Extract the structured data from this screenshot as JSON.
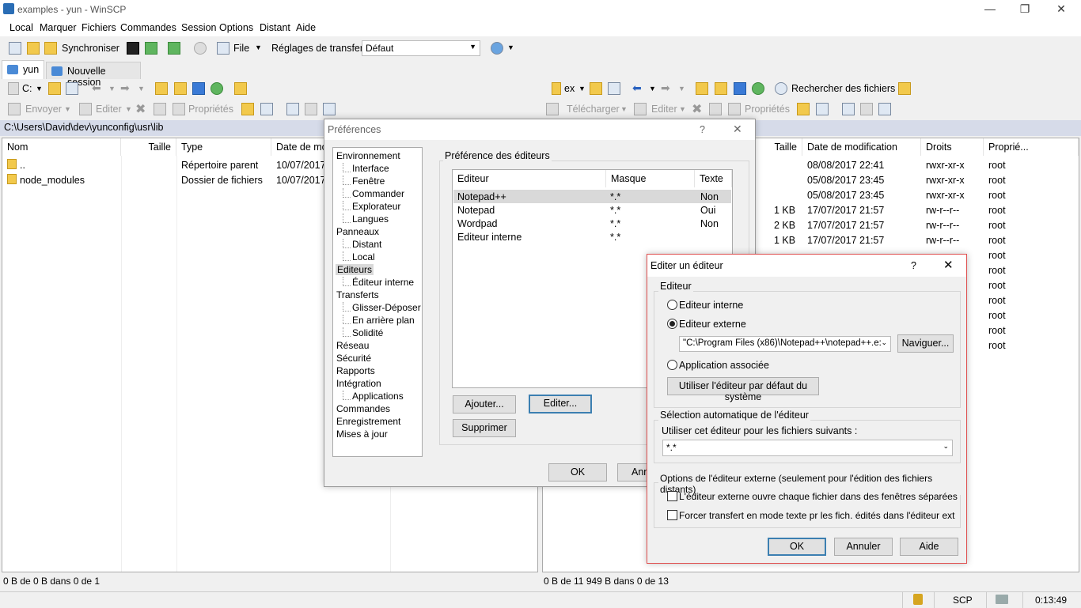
{
  "window": {
    "title": "examples - yun - WinSCP",
    "min": "—",
    "restore": "❐",
    "close": "✕"
  },
  "menu": [
    "Local",
    "Marquer",
    "Fichiers",
    "Commandes",
    "Session",
    "Options",
    "Distant",
    "Aide"
  ],
  "toolbar": {
    "sync_label": "Synchroniser",
    "file_label": "File",
    "transfer_settings_label": "Réglages de transfert",
    "transfer_preset": "Défaut"
  },
  "tabs": [
    {
      "label": "yun"
    },
    {
      "label": "Nouvelle session"
    }
  ],
  "local": {
    "drive": "C:",
    "send_label": "Envoyer",
    "edit_label": "Editer",
    "props_label": "Propriétés",
    "path": "C:\\Users\\David\\dev\\yunconfig\\usr\\lib",
    "columns": [
      "Nom",
      "Taille",
      "Type",
      "Date de mo"
    ],
    "rows": [
      {
        "name": "..",
        "type": "Répertoire parent",
        "date": "10/07/2017"
      },
      {
        "name": "node_modules",
        "type": "Dossier de fichiers",
        "date": "10/07/2017"
      }
    ],
    "status": "0 B de 0 B dans 0 de 1"
  },
  "remote": {
    "dir": "ex",
    "find_label": "Rechercher des fichiers",
    "download_label": "Télécharger",
    "edit_label": "Editer",
    "props_label": "Propriétés",
    "columns": [
      "Taille",
      "Date de modification",
      "Droits",
      "Proprié..."
    ],
    "rows": [
      {
        "size": "",
        "date": "08/08/2017 22:41",
        "rights": "rwxr-xr-x",
        "owner": "root"
      },
      {
        "size": "",
        "date": "05/08/2017 23:45",
        "rights": "rwxr-xr-x",
        "owner": "root"
      },
      {
        "size": "",
        "date": "05/08/2017 23:45",
        "rights": "rwxr-xr-x",
        "owner": "root"
      },
      {
        "size": "1 KB",
        "date": "17/07/2017 21:57",
        "rights": "rw-r--r--",
        "owner": "root"
      },
      {
        "size": "2 KB",
        "date": "17/07/2017 21:57",
        "rights": "rw-r--r--",
        "owner": "root"
      },
      {
        "size": "1 KB",
        "date": "17/07/2017 21:57",
        "rights": "rw-r--r--",
        "owner": "root"
      },
      {
        "size": "",
        "date": "",
        "rights": "",
        "owner": "root"
      },
      {
        "size": "",
        "date": "",
        "rights": "",
        "owner": "root"
      },
      {
        "size": "",
        "date": "",
        "rights": "",
        "owner": "root"
      },
      {
        "size": "",
        "date": "",
        "rights": "",
        "owner": "root"
      },
      {
        "size": "",
        "date": "",
        "rights": "",
        "owner": "root"
      },
      {
        "size": "",
        "date": "",
        "rights": "",
        "owner": "root"
      },
      {
        "size": "",
        "date": "",
        "rights": "",
        "owner": "root"
      }
    ],
    "status": "0 B de 11 949 B dans 0 de 13"
  },
  "bottom": {
    "protocol": "SCP",
    "time": "0:13:49"
  },
  "prefs": {
    "title": "Préférences",
    "help": "?",
    "close": "✕",
    "tree": [
      {
        "label": "Environnement",
        "level": 0
      },
      {
        "label": "Interface",
        "level": 1
      },
      {
        "label": "Fenêtre",
        "level": 1
      },
      {
        "label": "Commander",
        "level": 1
      },
      {
        "label": "Explorateur",
        "level": 1
      },
      {
        "label": "Langues",
        "level": 1
      },
      {
        "label": "Panneaux",
        "level": 0
      },
      {
        "label": "Distant",
        "level": 1
      },
      {
        "label": "Local",
        "level": 1
      },
      {
        "label": "Editeurs",
        "level": 0,
        "selected": true
      },
      {
        "label": "Éditeur interne",
        "level": 1
      },
      {
        "label": "Transferts",
        "level": 0
      },
      {
        "label": "Glisser-Déposer",
        "level": 1
      },
      {
        "label": "En arrière plan",
        "level": 1
      },
      {
        "label": "Solidité",
        "level": 1
      },
      {
        "label": "Réseau",
        "level": 0
      },
      {
        "label": "Sécurité",
        "level": 0
      },
      {
        "label": "Rapports",
        "level": 0
      },
      {
        "label": "Intégration",
        "level": 0
      },
      {
        "label": "Applications",
        "level": 1
      },
      {
        "label": "Commandes",
        "level": 0
      },
      {
        "label": "Enregistrement",
        "level": 0
      },
      {
        "label": "Mises à jour",
        "level": 0
      }
    ],
    "group_label": "Préférence des éditeurs",
    "columns": [
      "Editeur",
      "Masque",
      "Texte"
    ],
    "editors": [
      {
        "name": "Notepad++",
        "mask": "*.*",
        "text": "Non"
      },
      {
        "name": "Notepad",
        "mask": "*.*",
        "text": "Oui"
      },
      {
        "name": "Wordpad",
        "mask": "*.*",
        "text": "Non"
      },
      {
        "name": "Editeur interne",
        "mask": "*.*",
        "text": ""
      }
    ],
    "add_label": "Ajouter...",
    "edit_label": "Editer...",
    "delete_label": "Supprimer",
    "ok_label": "OK",
    "cancel_label": "Ann"
  },
  "edit_dialog": {
    "title": "Editer un éditeur",
    "help": "?",
    "close": "✕",
    "editor_group": "Editeur",
    "internal_label": "Editeur interne",
    "external_label": "Editeur externe",
    "external_path": "\"C:\\Program Files (x86)\\Notepad++\\notepad++.e:",
    "browse_label": "Naviguer...",
    "assoc_label": "Application associée",
    "default_editor_label": "Utiliser l'éditeur par défaut du système",
    "auto_group": "Sélection automatique de l'éditeur",
    "use_for_label": "Utiliser cet éditeur pour les fichiers suivants :",
    "mask_value": "*.*",
    "ext_options_group": "Options de l'éditeur externe (seulement pour l'édition des fichiers distants)",
    "opt1_label": "L'éditeur externe ouvre chaque fichier dans des fenêtres séparées",
    "opt2_label": "Forcer transfert en mode texte pr les fich. édités dans l'éditeur ext",
    "ok_label": "OK",
    "cancel_label": "Annuler",
    "help_label": "Aide"
  },
  "colors": {
    "path_bar": "#d6dbe9",
    "accent": "#3c7fb1",
    "dialog_border": "#e05050",
    "selection": "#d9d9d9"
  }
}
